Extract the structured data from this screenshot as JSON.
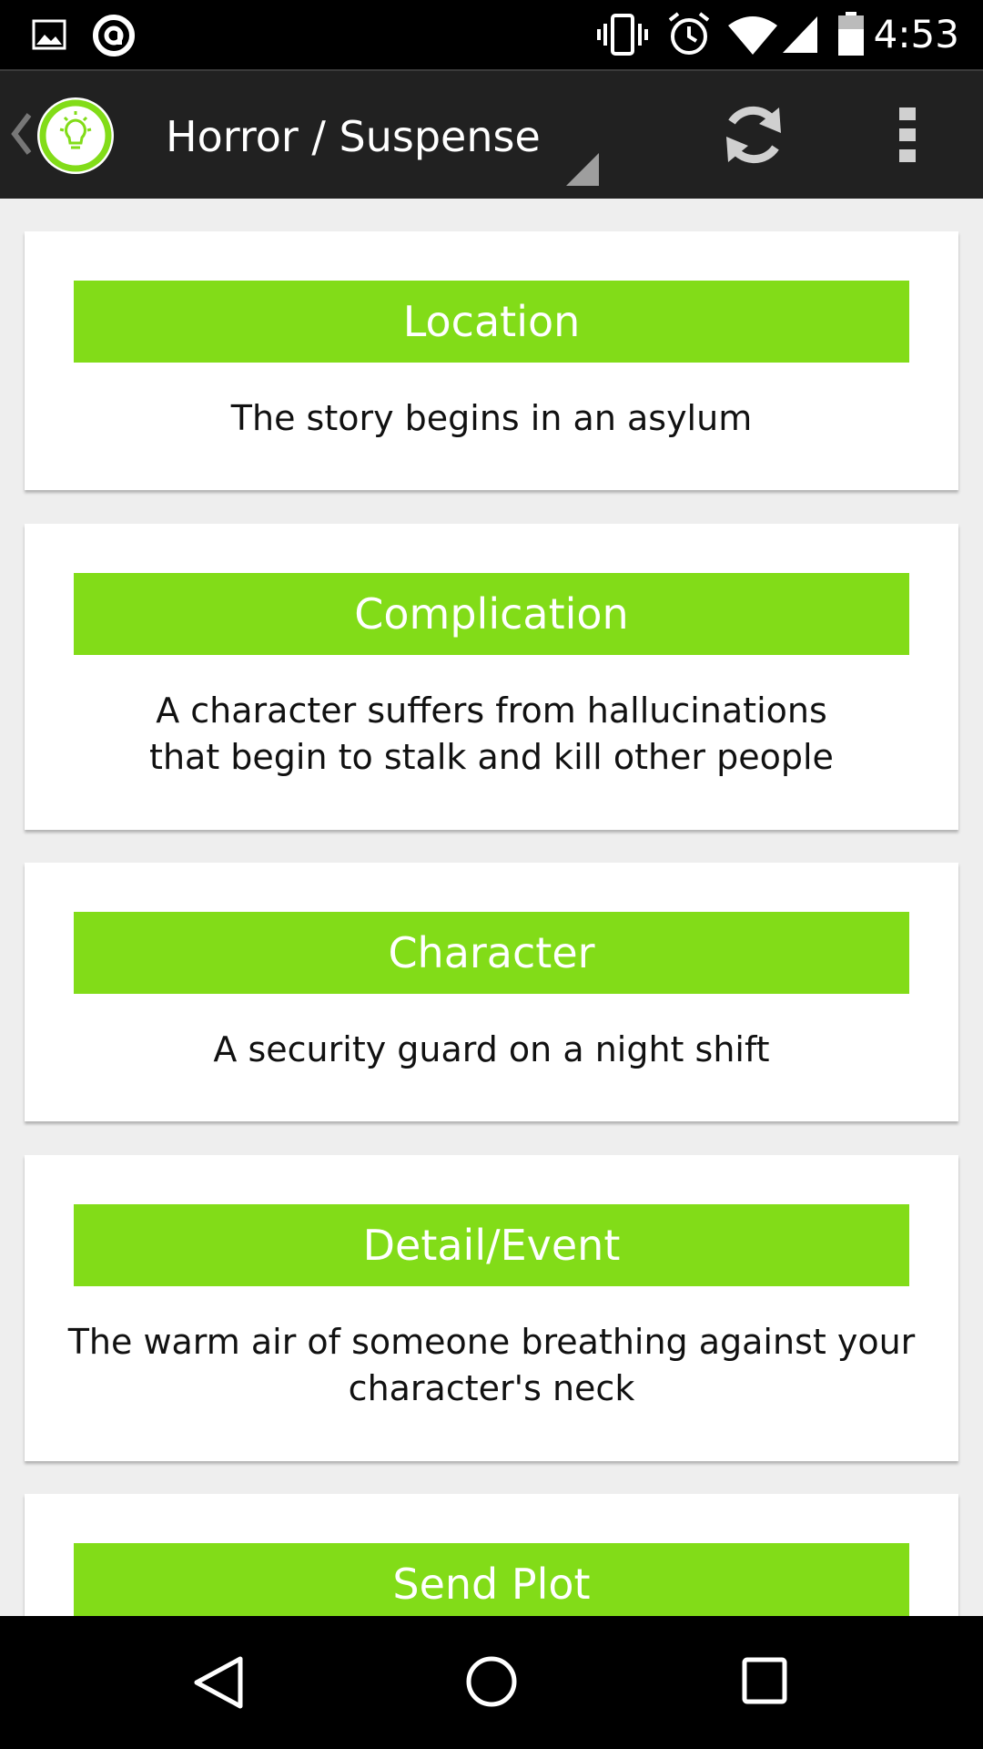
{
  "status_bar": {
    "time": "4:53",
    "icons": [
      "image-notification-icon",
      "app-notification-icon",
      "vibrate-icon",
      "alarm-icon",
      "wifi-icon",
      "cell-signal-icon",
      "battery-icon"
    ]
  },
  "action_bar": {
    "title": "Horror / Suspense",
    "icons": [
      "up-chevron-icon",
      "lightbulb-logo-icon",
      "spinner-arrow-icon",
      "refresh-icon",
      "overflow-menu-icon"
    ]
  },
  "cards": [
    {
      "heading": "Location",
      "text": "The story begins in an asylum"
    },
    {
      "heading": "Complication",
      "text": "A character suffers from hallucinations that begin to stalk and kill other people"
    },
    {
      "heading": "Character",
      "text": "A security guard on a night shift"
    },
    {
      "heading": "Detail/Event",
      "text": "The warm air of someone breathing against your character's neck"
    }
  ],
  "send_button": {
    "label": "Send Plot"
  },
  "nav_bar": {
    "icons": [
      "back-icon",
      "home-icon",
      "recents-icon"
    ]
  },
  "colors": {
    "accent": "#82dc18",
    "action_bar": "#212121",
    "background": "#eeeeee",
    "card": "#ffffff"
  }
}
